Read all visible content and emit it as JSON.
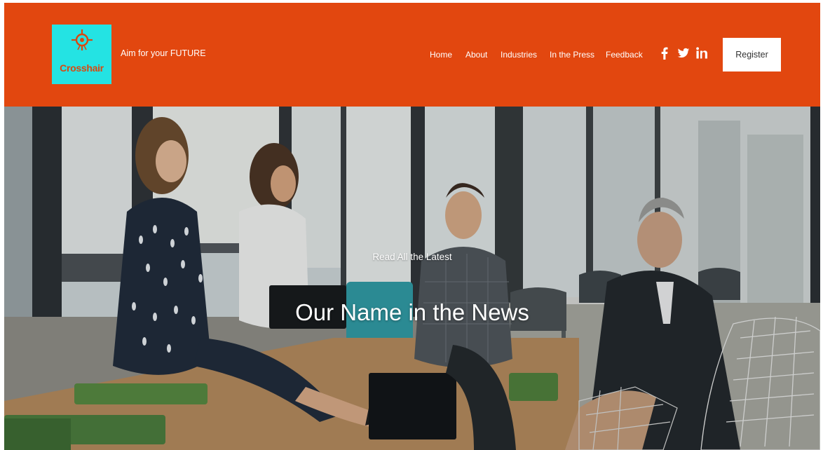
{
  "brand": {
    "logo_name": "Crosshair",
    "logo_tag": "",
    "tagline": "Aim for your FUTURE",
    "logo_bg_color": "#24e3e3",
    "logo_text_color": "#d9480f"
  },
  "header": {
    "bg_color": "#e2470f"
  },
  "nav": {
    "items": [
      {
        "label": "Home"
      },
      {
        "label": "About"
      },
      {
        "label": "Industries"
      },
      {
        "label": "In the Press"
      },
      {
        "label": "Feedback"
      }
    ]
  },
  "social": {
    "items": [
      {
        "icon": "facebook-icon"
      },
      {
        "icon": "twitter-icon"
      },
      {
        "icon": "linkedin-icon"
      }
    ]
  },
  "register": {
    "label": "Register"
  },
  "hero": {
    "eyebrow": "Read All the Latest",
    "title": "Our Name in the News",
    "image": "office-meeting-photo"
  }
}
